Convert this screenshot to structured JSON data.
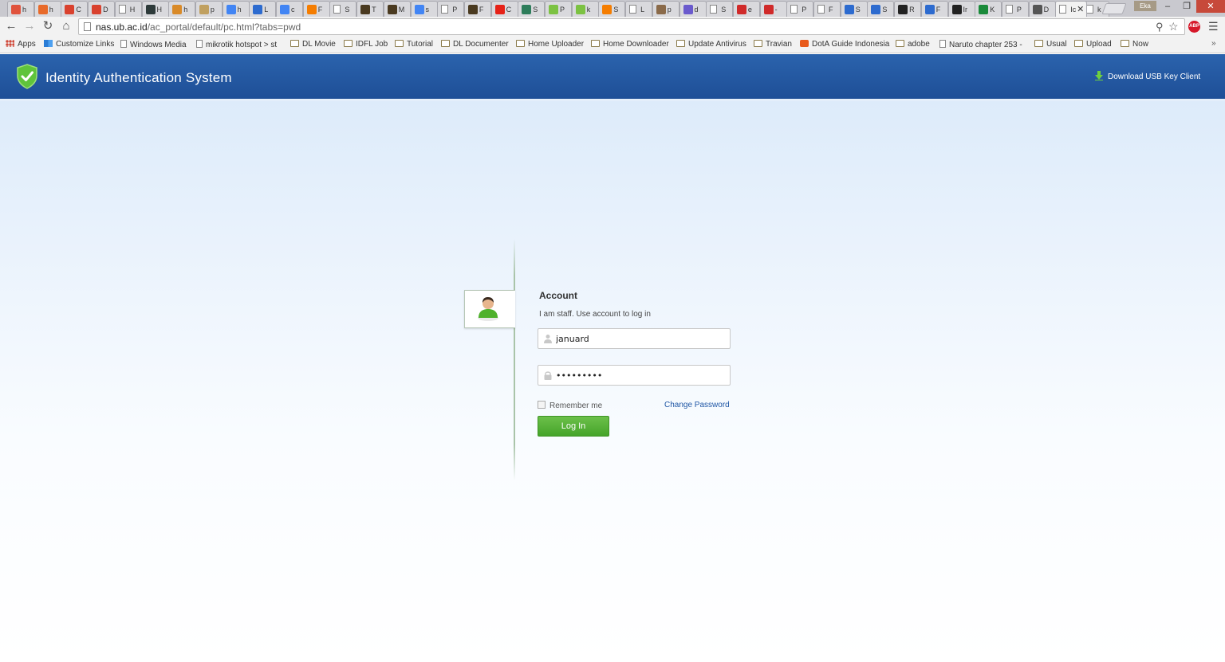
{
  "browser": {
    "tabs": [
      {
        "label": "h",
        "color": "#e0533d"
      },
      {
        "label": "h",
        "color": "#e86a2a"
      },
      {
        "label": "C",
        "color": "#d9412e"
      },
      {
        "label": "D",
        "color": "#d9412e"
      },
      {
        "label": "H",
        "color": ""
      },
      {
        "label": "H",
        "color": "#2d3a3a"
      },
      {
        "label": "h",
        "color": "#d98a28"
      },
      {
        "label": "p",
        "color": "#c0a060"
      },
      {
        "label": "h",
        "color": "#4285f4"
      },
      {
        "label": "L",
        "color": "#2d6bcf"
      },
      {
        "label": "c",
        "color": "#4285f4"
      },
      {
        "label": "F",
        "color": "#f57d00"
      },
      {
        "label": "S",
        "color": ""
      },
      {
        "label": "T",
        "color": "#4a3a20"
      },
      {
        "label": "M",
        "color": "#4a3a20"
      },
      {
        "label": "s",
        "color": "#4285f4"
      },
      {
        "label": "P",
        "color": ""
      },
      {
        "label": "F",
        "color": "#4a3a20"
      },
      {
        "label": "C",
        "color": "#e62117"
      },
      {
        "label": "S",
        "color": "#2e7d5b"
      },
      {
        "label": "P",
        "color": "#7cc242"
      },
      {
        "label": "k",
        "color": "#7cc242"
      },
      {
        "label": "S",
        "color": "#f57d00"
      },
      {
        "label": "L",
        "color": ""
      },
      {
        "label": "p",
        "color": "#8a6a4a"
      },
      {
        "label": "d",
        "color": "#6a5acd"
      },
      {
        "label": "S",
        "color": ""
      },
      {
        "label": "e",
        "color": "#d02a2a"
      },
      {
        "label": "-",
        "color": "#d02a2a"
      },
      {
        "label": "P",
        "color": ""
      },
      {
        "label": "F",
        "color": ""
      },
      {
        "label": "S",
        "color": "#2d6bcf"
      },
      {
        "label": "S",
        "color": "#2d6bcf"
      },
      {
        "label": "R",
        "color": "#222"
      },
      {
        "label": "F",
        "color": "#2d6bcf"
      },
      {
        "label": "Ir",
        "color": "#222"
      },
      {
        "label": "K",
        "color": "#1a8a3a"
      },
      {
        "label": "P",
        "color": ""
      },
      {
        "label": "D",
        "color": "#555"
      },
      {
        "label": "Ic",
        "color": "",
        "active": true
      },
      {
        "label": "k",
        "color": ""
      }
    ],
    "profile_name": "Eka",
    "url_host": "nas.ub.ac.id",
    "url_path": "/ac_portal/default/pc.html?tabs=pwd",
    "abp_label": "ABP"
  },
  "bookmarks": [
    {
      "label": "Apps",
      "icon": "apps"
    },
    {
      "label": "Customize Links",
      "icon": "win"
    },
    {
      "label": "Windows Media",
      "icon": "page"
    },
    {
      "label": "mikrotik hotspot > st",
      "icon": "page"
    },
    {
      "label": "DL Movie",
      "icon": "folder"
    },
    {
      "label": "IDFL Job",
      "icon": "folder"
    },
    {
      "label": "Tutorial",
      "icon": "folder"
    },
    {
      "label": "DL Documenter",
      "icon": "folder"
    },
    {
      "label": "Home Uploader",
      "icon": "folder"
    },
    {
      "label": "Home Downloader",
      "icon": "folder"
    },
    {
      "label": "Update Antivirus",
      "icon": "folder"
    },
    {
      "label": "Travian",
      "icon": "folder"
    },
    {
      "label": "DotA Guide Indonesia",
      "icon": "orange"
    },
    {
      "label": "adobe",
      "icon": "folder"
    },
    {
      "label": "Naruto chapter 253 -",
      "icon": "page"
    },
    {
      "label": "Usual",
      "icon": "folder"
    },
    {
      "label": "Upload",
      "icon": "folder"
    },
    {
      "label": "Now",
      "icon": "folder"
    }
  ],
  "header": {
    "title": "Identity Authentication System",
    "download_label": "Download USB Key Client"
  },
  "login": {
    "account_title": "Account",
    "account_desc": "I am staff. Use account to log in",
    "username_value": "januard",
    "password_value": "secret123",
    "remember_label": "Remember me",
    "remember_checked": false,
    "change_password_label": "Change Password",
    "login_button_label": "Log In"
  },
  "colors": {
    "header_blue": "#2b63ad",
    "login_green": "#55b035",
    "link_blue": "#1f56a5"
  }
}
